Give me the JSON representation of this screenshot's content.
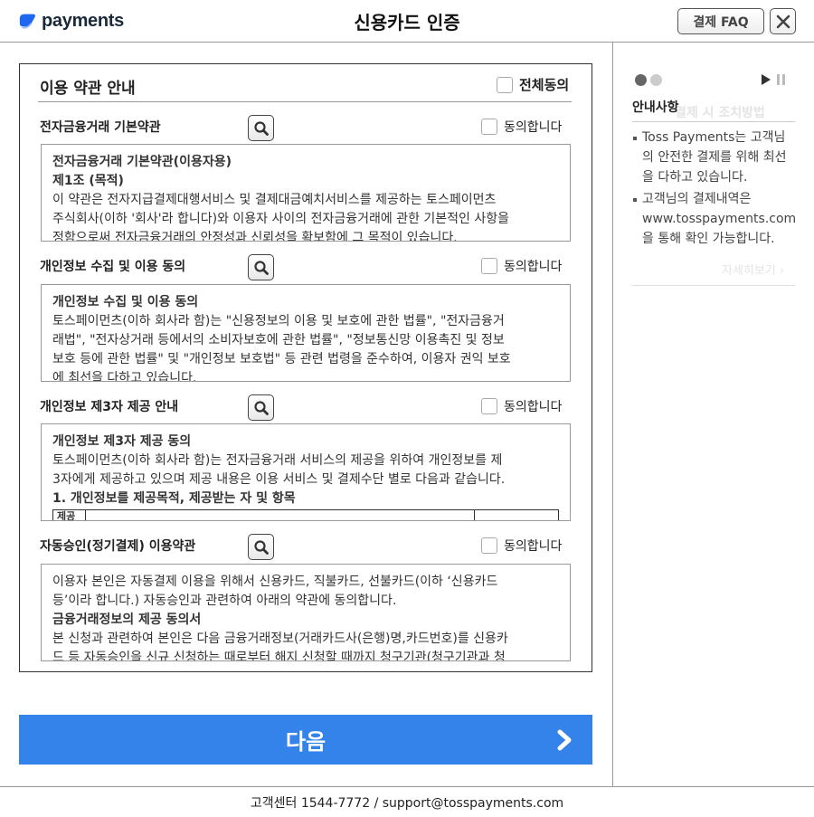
{
  "header": {
    "logo_text": "payments",
    "title": "신용카드 인증",
    "faq_label": "결제 FAQ"
  },
  "terms": {
    "title": "이용 약관 안내",
    "all_agree_label": "전체동의",
    "sections": [
      {
        "heading": "전자금융거래 기본약관",
        "agree_label": "동의합니다",
        "lines": [
          {
            "text": "전자금융거래 기본약관(이용자용)",
            "bold": true
          },
          {
            "text": "제1조 (목적)",
            "bold": true
          },
          {
            "text": "이 약관은 전자지급결제대행서비스 및 결제대금예치서비스를 제공하는 토스페이먼츠",
            "bold": false
          },
          {
            "text": "주식회사(이하 '회사'라 합니다)와 이용자 사이의 전자금융거래에 관한 기본적인 사항을",
            "bold": false
          },
          {
            "text": "정함으로써 전자금융거래의 안정성과 신뢰성을 확보함에 그 목적이 있습니다.",
            "bold": false
          }
        ]
      },
      {
        "heading": "개인정보 수집 및 이용 동의",
        "agree_label": "동의합니다",
        "lines": [
          {
            "text": "개인정보 수집 및 이용 동의",
            "bold": true
          },
          {
            "text": "토스페이먼츠(이하 회사라 함)는 \"신용정보의 이용 및 보호에 관한 법률\", \"전자금융거",
            "bold": false
          },
          {
            "text": "래법\", \"전자상거래 등에서의 소비자보호에 관한 법률\", \"정보통신망 이용촉진 및 정보",
            "bold": false
          },
          {
            "text": "보호 등에 관한 법률\" 및 \"개인정보 보호법\" 등 관련 법령을 준수하여, 이용자 권익 보호",
            "bold": false
          },
          {
            "text": "에 최선을 다하고 있습니다.",
            "bold": false
          }
        ]
      },
      {
        "heading": "개인정보 제3자 제공 안내",
        "agree_label": "동의합니다",
        "lines": [
          {
            "text": "개인정보 제3자 제공 동의",
            "bold": true
          },
          {
            "text": "토스페이먼츠(이하 회사라 함)는 전자금융거래 서비스의 제공을 위하여 개인정보를 제",
            "bold": false
          },
          {
            "text": "3자에게 제공하고 있으며 제공 내용은 이용 서비스 및 결제수단 별로 다음과 같습니다.",
            "bold": false
          },
          {
            "text": "1. 개인정보를 제공목적, 제공받는 자 및 항목",
            "bold": true
          }
        ],
        "table_header": "제공"
      },
      {
        "heading": "자동승인(정기결제) 이용약관",
        "agree_label": "동의합니다",
        "lines": [
          {
            "text": "이용자 본인은 자동결제 이용을 위해서 신용카드, 직불카드, 선불카드(이하 ‘신용카드",
            "bold": false
          },
          {
            "text": "등’이라 합니다.) 자동승인과 관련하여 아래의 약관에 동의합니다.",
            "bold": false
          },
          {
            "text": "금융거래정보의 제공 동의서",
            "bold": true
          },
          {
            "text": "본 신청과 관련하여 본인은 다음 금융거래정보(거래카드사(은행)명,카드번호)를 신용카",
            "bold": false
          },
          {
            "text": "드 등 자동승인을 신규 신청하는 때로부터 해지 신청할 때까지 청구기관(청구기관과 청",
            "bold": false
          }
        ]
      }
    ]
  },
  "next_button": {
    "label": "다음"
  },
  "footer": {
    "text": "고객센터 1544-7772 / support@tosspayments.com"
  },
  "side_panel": {
    "title": "안내사항",
    "bullets": [
      {
        "text": "Toss Payments는 고객님의 안전한 결제를 위해 최선을 다하고 있습니다."
      },
      {
        "text": "고객님의 결제내역은"
      },
      {
        "text": "www.tosspayments.com"
      },
      {
        "text": "을 통해 확인 가능합니다."
      }
    ],
    "ghost_title": "결제 시 조치방법",
    "ghost_more": "자세히보기 ›"
  },
  "colors": {
    "accent": "#3483ea",
    "logo_blue": "#1f66f0",
    "dot_active": "#666666",
    "dot_inactive": "#cccccc"
  }
}
